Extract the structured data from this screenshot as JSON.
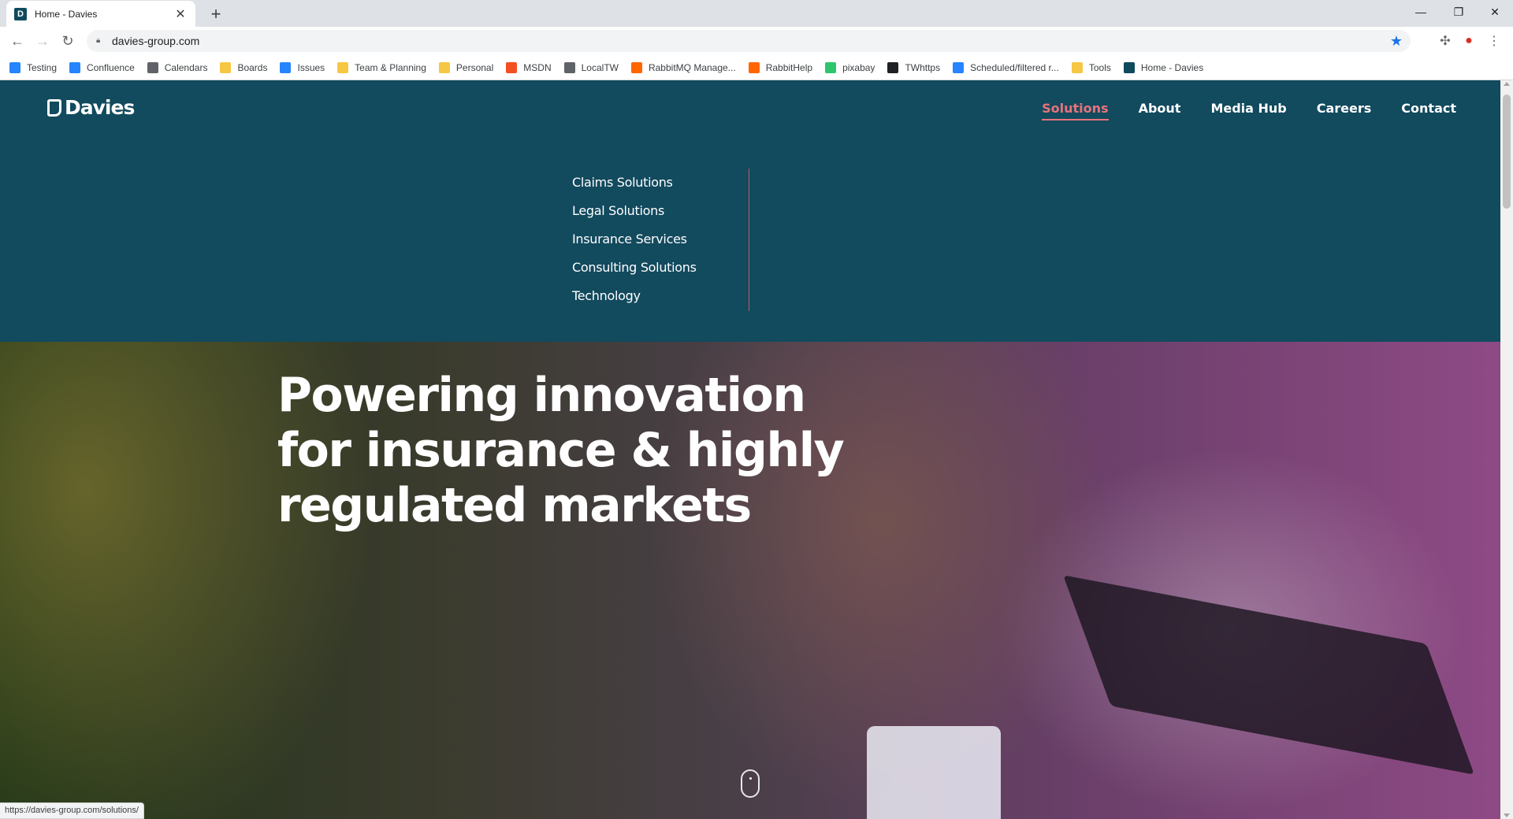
{
  "browser": {
    "tab_title": "Home - Davies",
    "tab_close": "✕",
    "new_tab": "+",
    "url": "davies-group.com",
    "status_url": "https://davies-group.com/solutions/",
    "window_controls": {
      "minimize": "—",
      "restore": "❐",
      "close": "✕"
    },
    "bookmarks": [
      {
        "label": "Testing",
        "icon": "jira-icon",
        "color": "#2684ff"
      },
      {
        "label": "Confluence",
        "icon": "confluence-icon",
        "color": "#2684ff"
      },
      {
        "label": "Calendars",
        "icon": "calendar-icon",
        "color": "#5f6368"
      },
      {
        "label": "Boards",
        "icon": "folder-icon",
        "color": "#f6c744"
      },
      {
        "label": "Issues",
        "icon": "jira-icon",
        "color": "#2684ff"
      },
      {
        "label": "Team & Planning",
        "icon": "folder-icon",
        "color": "#f6c744"
      },
      {
        "label": "Personal",
        "icon": "folder-icon",
        "color": "#f6c744"
      },
      {
        "label": "MSDN",
        "icon": "microsoft-icon",
        "color": "#f25022"
      },
      {
        "label": "LocalTW",
        "icon": "laptop-icon",
        "color": "#5f6368"
      },
      {
        "label": "RabbitMQ Manage...",
        "icon": "rabbitmq-icon",
        "color": "#ff6600"
      },
      {
        "label": "RabbitHelp",
        "icon": "rabbitmq-icon",
        "color": "#ff6600"
      },
      {
        "label": "pixabay",
        "icon": "pixabay-icon",
        "color": "#2ec66d"
      },
      {
        "label": "TWhttps",
        "icon": "circle-icon",
        "color": "#202124"
      },
      {
        "label": "Scheduled/filtered r...",
        "icon": "confluence-icon",
        "color": "#2684ff"
      },
      {
        "label": "Tools",
        "icon": "folder-icon",
        "color": "#f6c744"
      },
      {
        "label": "Home - Davies",
        "icon": "davies-icon",
        "color": "#0f4a5c"
      }
    ]
  },
  "site": {
    "logo_text": "Davies",
    "nav": [
      {
        "label": "Solutions",
        "active": true
      },
      {
        "label": "About",
        "active": false
      },
      {
        "label": "Media Hub",
        "active": false
      },
      {
        "label": "Careers",
        "active": false
      },
      {
        "label": "Contact",
        "active": false
      }
    ],
    "solutions_menu": [
      "Claims Solutions",
      "Legal Solutions",
      "Insurance Services",
      "Consulting Solutions",
      "Technology"
    ],
    "hero_headline": "Powering innovation for insurance & highly regulated markets",
    "colors": {
      "header_bg": "#124a5e",
      "accent": "#e8737b"
    }
  }
}
